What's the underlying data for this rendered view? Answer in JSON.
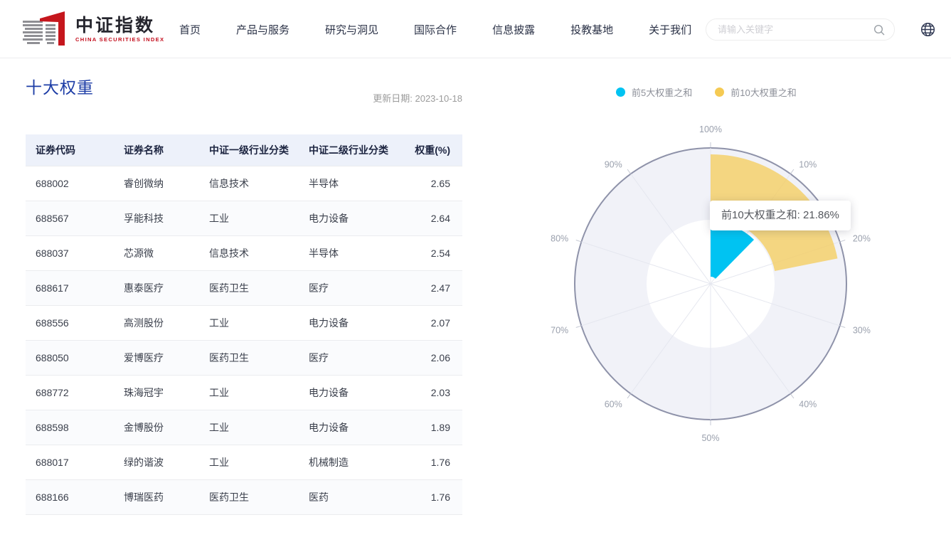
{
  "header": {
    "logo": {
      "title": "中证指数",
      "subtitle": "CHINA SECURITIES INDEX"
    },
    "nav": [
      "首页",
      "产品与服务",
      "研究与洞见",
      "国际合作",
      "信息披露",
      "投教基地",
      "关于我们"
    ],
    "search": {
      "placeholder": "请输入关键字"
    }
  },
  "main": {
    "title": "十大权重",
    "update_date": "更新日期: 2023-10-18",
    "table": {
      "columns": [
        "证券代码",
        "证券名称",
        "中证一级行业分类",
        "中证二级行业分类",
        "权重(%)"
      ],
      "rows": [
        [
          "688002",
          "睿创微纳",
          "信息技术",
          "半导体",
          "2.65"
        ],
        [
          "688567",
          "孚能科技",
          "工业",
          "电力设备",
          "2.64"
        ],
        [
          "688037",
          "芯源微",
          "信息技术",
          "半导体",
          "2.54"
        ],
        [
          "688617",
          "惠泰医疗",
          "医药卫生",
          "医疗",
          "2.47"
        ],
        [
          "688556",
          "高测股份",
          "工业",
          "电力设备",
          "2.07"
        ],
        [
          "688050",
          "爱博医疗",
          "医药卫生",
          "医疗",
          "2.06"
        ],
        [
          "688772",
          "珠海冠宇",
          "工业",
          "电力设备",
          "2.03"
        ],
        [
          "688598",
          "金博股份",
          "工业",
          "电力设备",
          "1.89"
        ],
        [
          "688017",
          "绿的谐波",
          "工业",
          "机械制造",
          "1.76"
        ],
        [
          "688166",
          "博瑞医药",
          "医药卫生",
          "医药",
          "1.76"
        ]
      ]
    }
  },
  "chart_data": {
    "type": "polar-bar",
    "angle_max": 100,
    "angle_unit": "%",
    "start_at_top": true,
    "clockwise": true,
    "angle_ticks": [
      "10%",
      "20%",
      "30%",
      "40%",
      "50%",
      "60%",
      "70%",
      "80%",
      "90%",
      "100%"
    ],
    "series": [
      {
        "name": "前5大权重之和",
        "value": 12.37,
        "color": "#00c3f2"
      },
      {
        "name": "前10大权重之和",
        "value": 21.86,
        "color": "#f5ca53"
      }
    ],
    "tooltip": {
      "text": "前10大权重之和: 21.86%"
    },
    "style": {
      "rim_color": "#8e92a9",
      "disk_fill": "#f1f2f8",
      "hole_fill": "#ffffff",
      "spoke_color": "#e5e7ef",
      "tick_color": "#c6c9d4",
      "label_color": "#9aa0ad"
    }
  }
}
